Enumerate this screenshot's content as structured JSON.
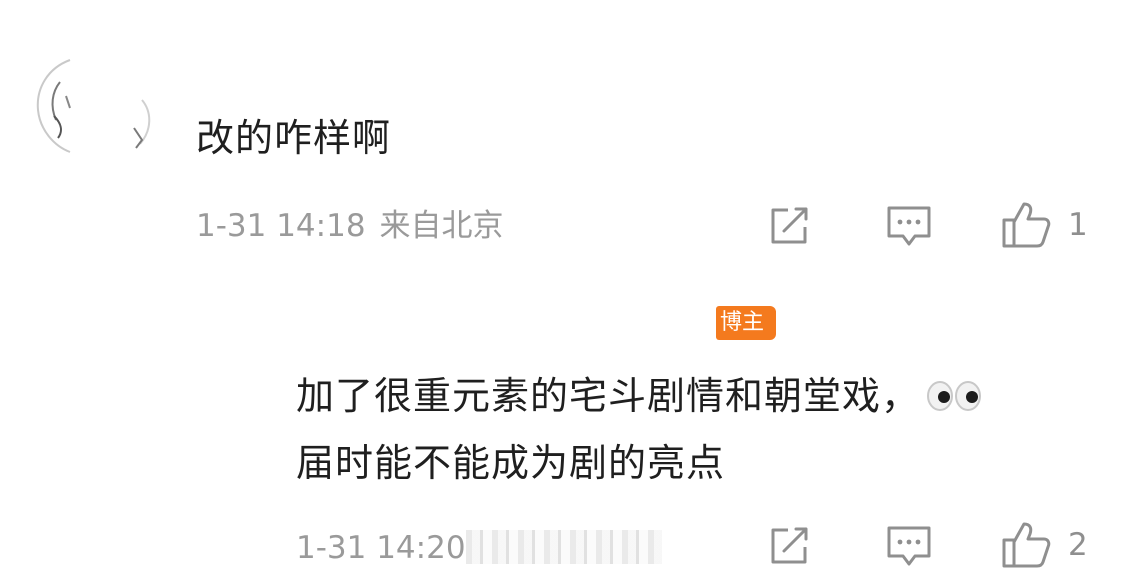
{
  "comment": {
    "text": "改的咋样啊",
    "time": "1-31 14:18",
    "location": "来自北京",
    "like_count": "1"
  },
  "reply": {
    "badge": "博主",
    "line1": "加了很重元素的宅斗剧情和朝堂戏，",
    "line2": "届时能不能成为剧的亮点",
    "time": "1-31 14:20",
    "like_count": "2"
  },
  "icons": {
    "share": "share-icon",
    "comment": "comment-icon",
    "like": "thumbs-up-icon",
    "emoji": "eyes-emoji"
  },
  "colors": {
    "badge": "#f47a1e",
    "meta_text": "#9a9a9a",
    "body_text": "#1f1f1f",
    "icon": "#8f8f8f"
  }
}
